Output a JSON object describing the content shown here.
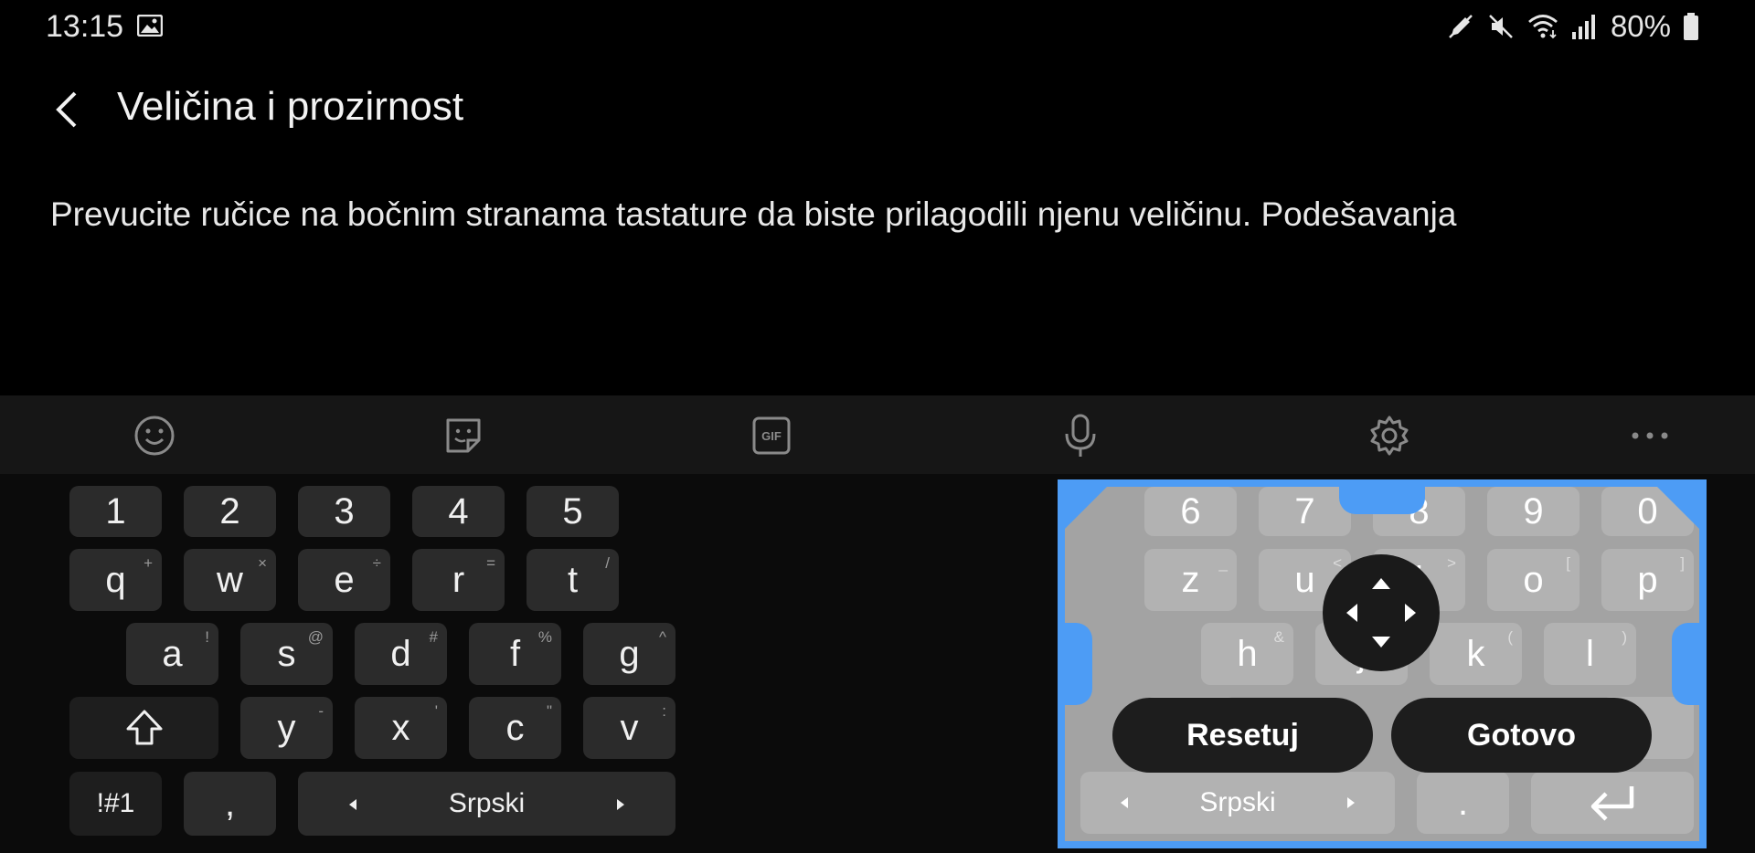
{
  "status_bar": {
    "time": "13:15",
    "battery": "80%",
    "icons": [
      "image-icon",
      "pen-icon",
      "mute-icon",
      "wifi-icon",
      "signal-icon",
      "battery-icon"
    ]
  },
  "header": {
    "title": "Veličina i prozirnost"
  },
  "description": "Prevucite ručice na bočnim stranama tastature da biste prilagodili njenu veličinu. Podešavanja",
  "toolbar": {
    "items": [
      "emoji-icon",
      "sticker-icon",
      "gif-icon",
      "microphone-icon",
      "settings-icon",
      "more-icon"
    ],
    "gif_label": "GIF"
  },
  "keyboard_left": {
    "numbers": [
      "1",
      "2",
      "3",
      "4",
      "5"
    ],
    "row_q": [
      {
        "k": "q",
        "s": "+"
      },
      {
        "k": "w",
        "s": "×"
      },
      {
        "k": "e",
        "s": "÷"
      },
      {
        "k": "r",
        "s": "="
      },
      {
        "k": "t",
        "s": "/"
      }
    ],
    "row_a": [
      {
        "k": "a",
        "s": "!"
      },
      {
        "k": "s",
        "s": "@"
      },
      {
        "k": "d",
        "s": "#"
      },
      {
        "k": "f",
        "s": "%"
      },
      {
        "k": "g",
        "s": "^"
      }
    ],
    "row_y": [
      {
        "k": "y",
        "s": "-"
      },
      {
        "k": "x",
        "s": "'"
      },
      {
        "k": "c",
        "s": "\""
      },
      {
        "k": "v",
        "s": ":"
      }
    ],
    "symbols_label": "!#1",
    "comma_label": ",",
    "language_label": "Srpski"
  },
  "keyboard_right": {
    "numbers": [
      "6",
      "7",
      "8",
      "9",
      "0"
    ],
    "row_z": [
      {
        "k": "z",
        "s": "_"
      },
      {
        "k": "u",
        "s": "<"
      },
      {
        "k": "i",
        "s": ">"
      },
      {
        "k": "o",
        "s": "["
      },
      {
        "k": "p",
        "s": "]"
      }
    ],
    "row_h": [
      {
        "k": "h",
        "s": "&"
      },
      {
        "k": "j",
        "s": ""
      },
      {
        "k": "k",
        "s": "("
      },
      {
        "k": "l",
        "s": ")"
      }
    ],
    "language_label": "Srpski",
    "period_label": ".",
    "reset_label": "Resetuj",
    "done_label": "Gotovo"
  }
}
